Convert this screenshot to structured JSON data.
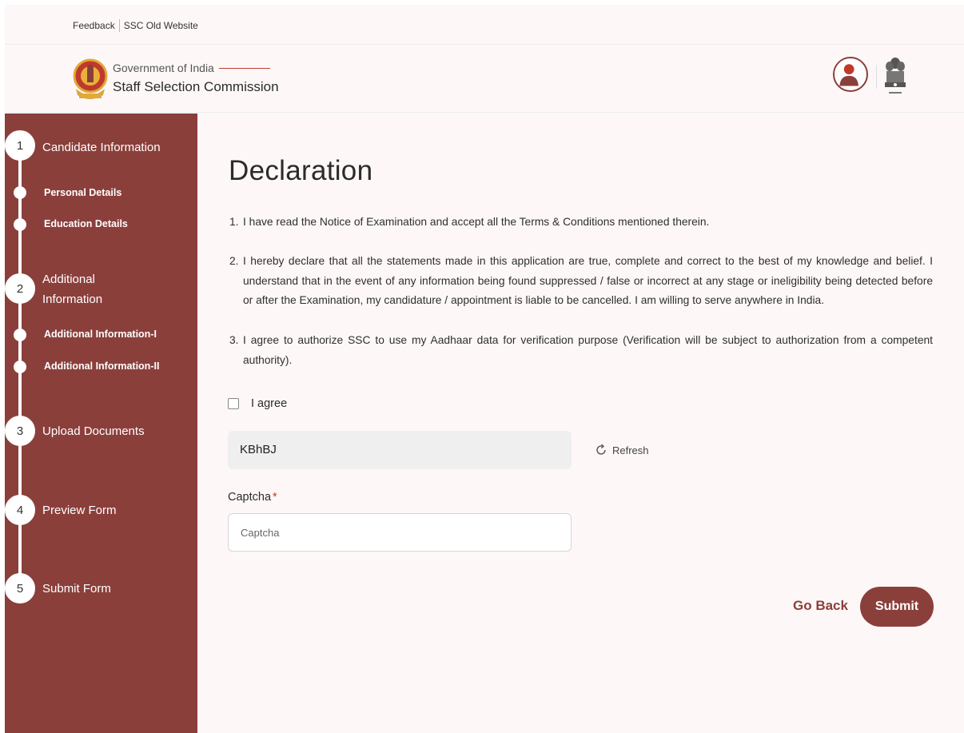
{
  "topbar": {
    "feedback": "Feedback",
    "old_site": "SSC Old Website"
  },
  "header": {
    "gov": "Government of India",
    "org": "Staff Selection Commission",
    "brand_color": "#8b3f3b"
  },
  "sidebar": {
    "steps": [
      {
        "num": "1",
        "label": "Candidate Information",
        "subs": [
          "Personal Details",
          "Education Details"
        ]
      },
      {
        "num": "2",
        "label": "Additional Information",
        "label_line1": "Additional",
        "label_line2": "Information",
        "subs": [
          "Additional Information-I",
          "Additional Information-II"
        ]
      },
      {
        "num": "3",
        "label": "Upload Documents"
      },
      {
        "num": "4",
        "label": "Preview Form"
      },
      {
        "num": "5",
        "label": "Submit Form"
      }
    ]
  },
  "main": {
    "title": "Declaration",
    "declarations": [
      {
        "num": "1.",
        "text": "I have read the Notice of Examination and accept all the Terms & Conditions mentioned therein."
      },
      {
        "num": "2.",
        "text": "I hereby declare that all the statements made in this application are true, complete and correct to the best of my knowledge and belief. I understand that in the event of any information being found suppressed / false or incorrect at any stage or ineligibility being detected before or after the Examination, my candidature / appointment is liable to be cancelled. I am willing to serve anywhere in India."
      },
      {
        "num": "3.",
        "text": "I agree to authorize SSC to use my Aadhaar data for verification purpose (Verification will be subject to authorization from a competent authority)."
      }
    ],
    "agree_label": "I agree",
    "captcha_code": "KBhBJ",
    "refresh_label": "Refresh",
    "captcha_label": "Captcha",
    "captcha_required": "*",
    "captcha_placeholder": "Captcha",
    "go_back": "Go Back",
    "submit": "Submit"
  }
}
